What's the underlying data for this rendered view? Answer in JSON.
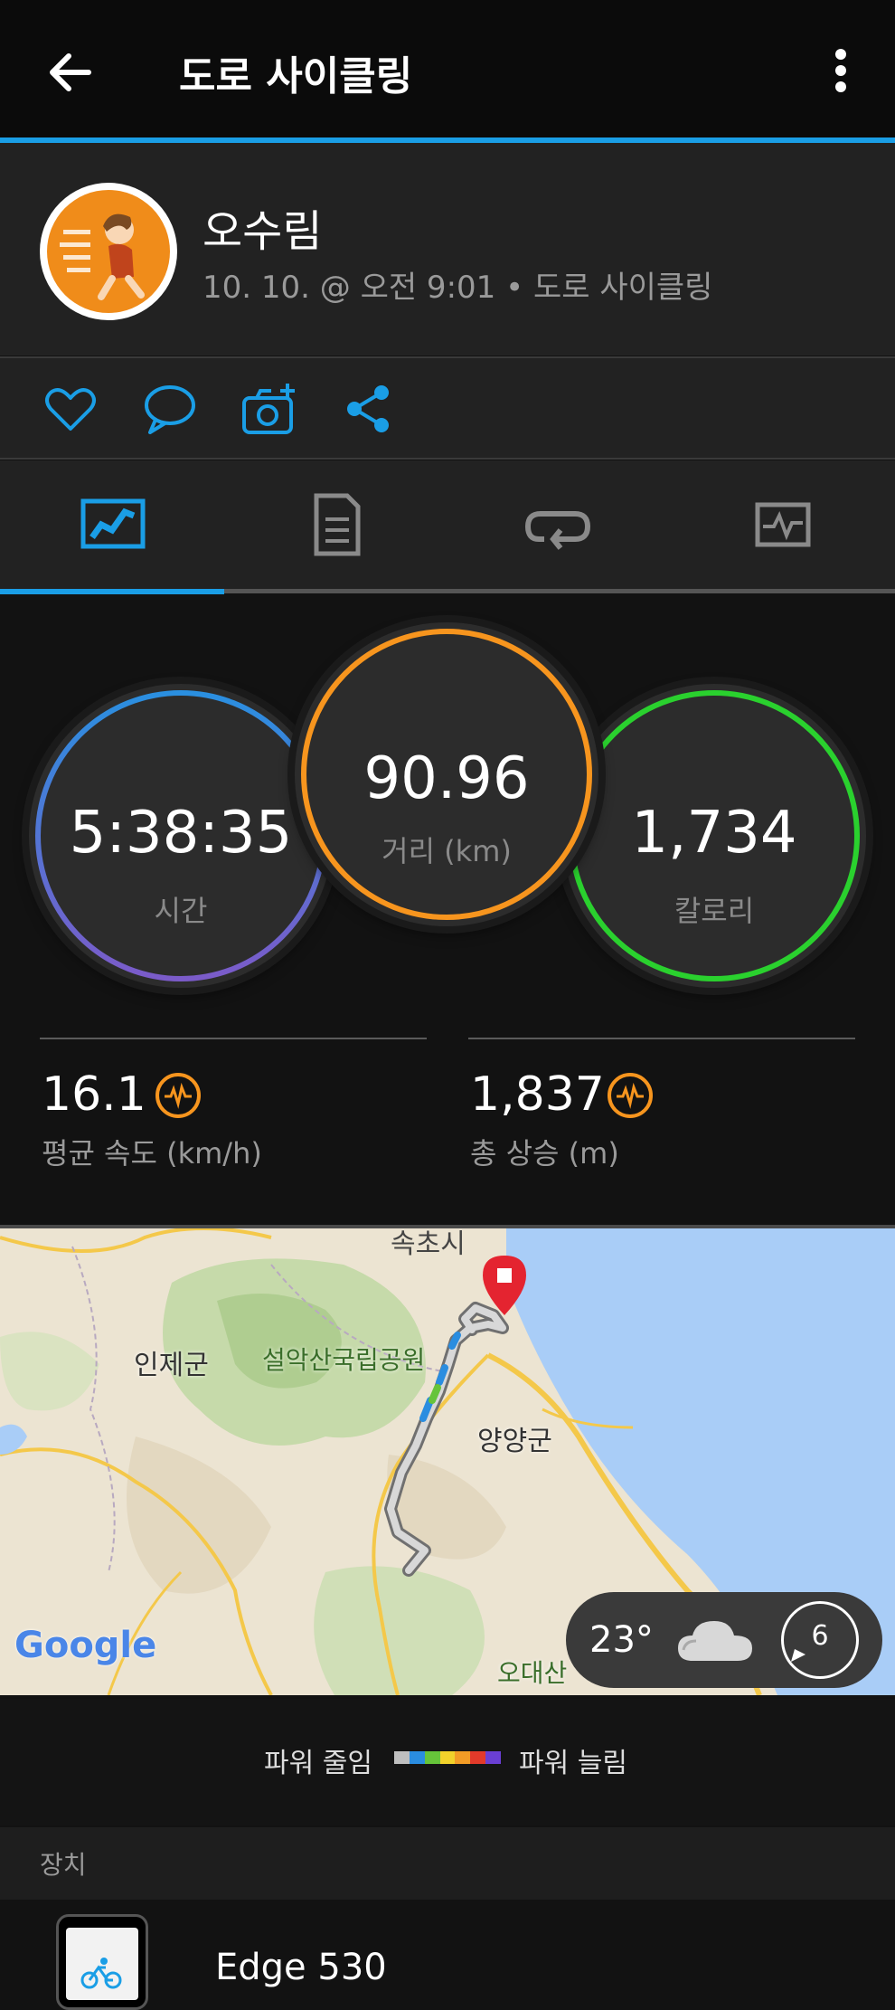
{
  "header": {
    "title": "도로 사이클링",
    "back_icon": "arrow-left-icon",
    "menu_icon": "more-vertical-icon"
  },
  "profile": {
    "name": "오수림",
    "meta": "10. 10. @ 오전 9:01 • 도로 사이클링"
  },
  "actions": [
    "heart-icon",
    "comment-icon",
    "add-photo-icon",
    "share-icon"
  ],
  "tabs": [
    "summary-tab",
    "details-tab",
    "laps-tab",
    "charts-tab"
  ],
  "circles": {
    "time": {
      "value": "5:38:35",
      "label": "시간"
    },
    "distance": {
      "value": "90.96",
      "label": "거리 (km)"
    },
    "calories": {
      "value": "1,734",
      "label": "칼로리"
    }
  },
  "stats": {
    "avg_speed": {
      "value": "16.1",
      "label": "평균 속도 (km/h)"
    },
    "ascent": {
      "value": "1,837",
      "label": "총 상승 (m)"
    }
  },
  "map": {
    "labels": {
      "top": "속초시",
      "inje": "인제군",
      "seorak": "설악산국립공원",
      "yangyang": "양양군",
      "odaesan": "오대산",
      "google": "Google"
    },
    "weather": {
      "temp": "23°",
      "wind": "6"
    }
  },
  "legend": {
    "left": "파워 줄임",
    "right": "파워 늘림",
    "colors": [
      "#bfbfbf",
      "#2a8de0",
      "#66c43a",
      "#f2d22b",
      "#f39c26",
      "#e23a2a",
      "#6a3fd3"
    ]
  },
  "device": {
    "section": "장치",
    "name": "Edge 530"
  },
  "colors": {
    "accent": "#1a9ee6",
    "distance_ring": "#f7951e",
    "calorie_ring": "#2ad12e",
    "time_ring_top": "#2a8fe0",
    "time_ring_bottom": "#7b5bc9"
  }
}
